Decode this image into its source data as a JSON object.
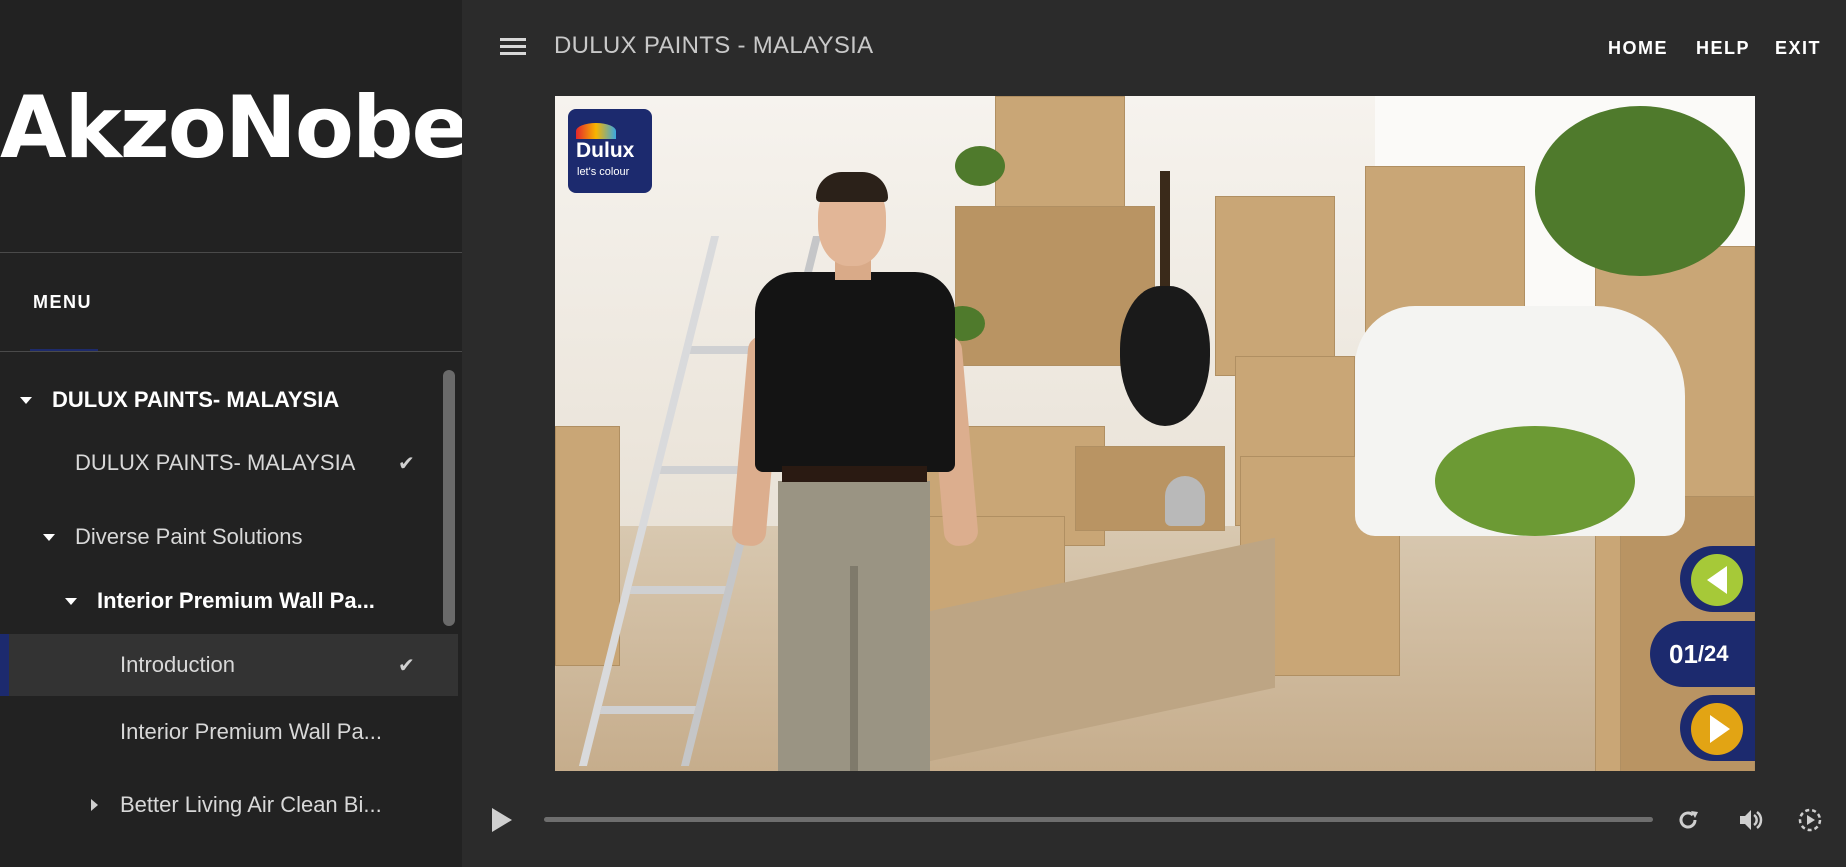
{
  "sidebar": {
    "logo_text": "AkzoNobel",
    "menu_label": "MENU",
    "toc": [
      {
        "label": "DULUX PAINTS- MALAYSIA"
      },
      {
        "label": "DULUX PAINTS- MALAYSIA",
        "checked": true
      },
      {
        "label": "Diverse Paint Solutions"
      },
      {
        "label": "Interior Premium Wall Pa..."
      },
      {
        "label": "Introduction",
        "checked": true,
        "active": true
      },
      {
        "label": "Interior Premium Wall Pa..."
      },
      {
        "label": "Better Living Air Clean Bi..."
      }
    ],
    "check_glyph": "✔"
  },
  "header": {
    "course_title": "DULUX PAINTS - MALAYSIA",
    "nav": {
      "home": "HOME",
      "help": "HELP",
      "exit": "EXIT"
    }
  },
  "slide": {
    "logo_brand": "Dulux",
    "logo_tagline": "let's colour",
    "counter_current": "01",
    "counter_total": "/24"
  },
  "player": {
    "progress_fraction": 0.0
  },
  "colors": {
    "accent_navy": "#1c2a6e",
    "prev_green": "#a6c938",
    "next_gold": "#e2a414",
    "sidebar_bg": "#222222",
    "main_bg": "#2b2b2b"
  },
  "icons": [
    "hamburger-icon",
    "play-icon",
    "replay-icon",
    "volume-icon",
    "speed-icon",
    "check-icon",
    "caret-down-icon",
    "caret-right-icon",
    "prev-arrow-icon",
    "next-arrow-icon"
  ]
}
